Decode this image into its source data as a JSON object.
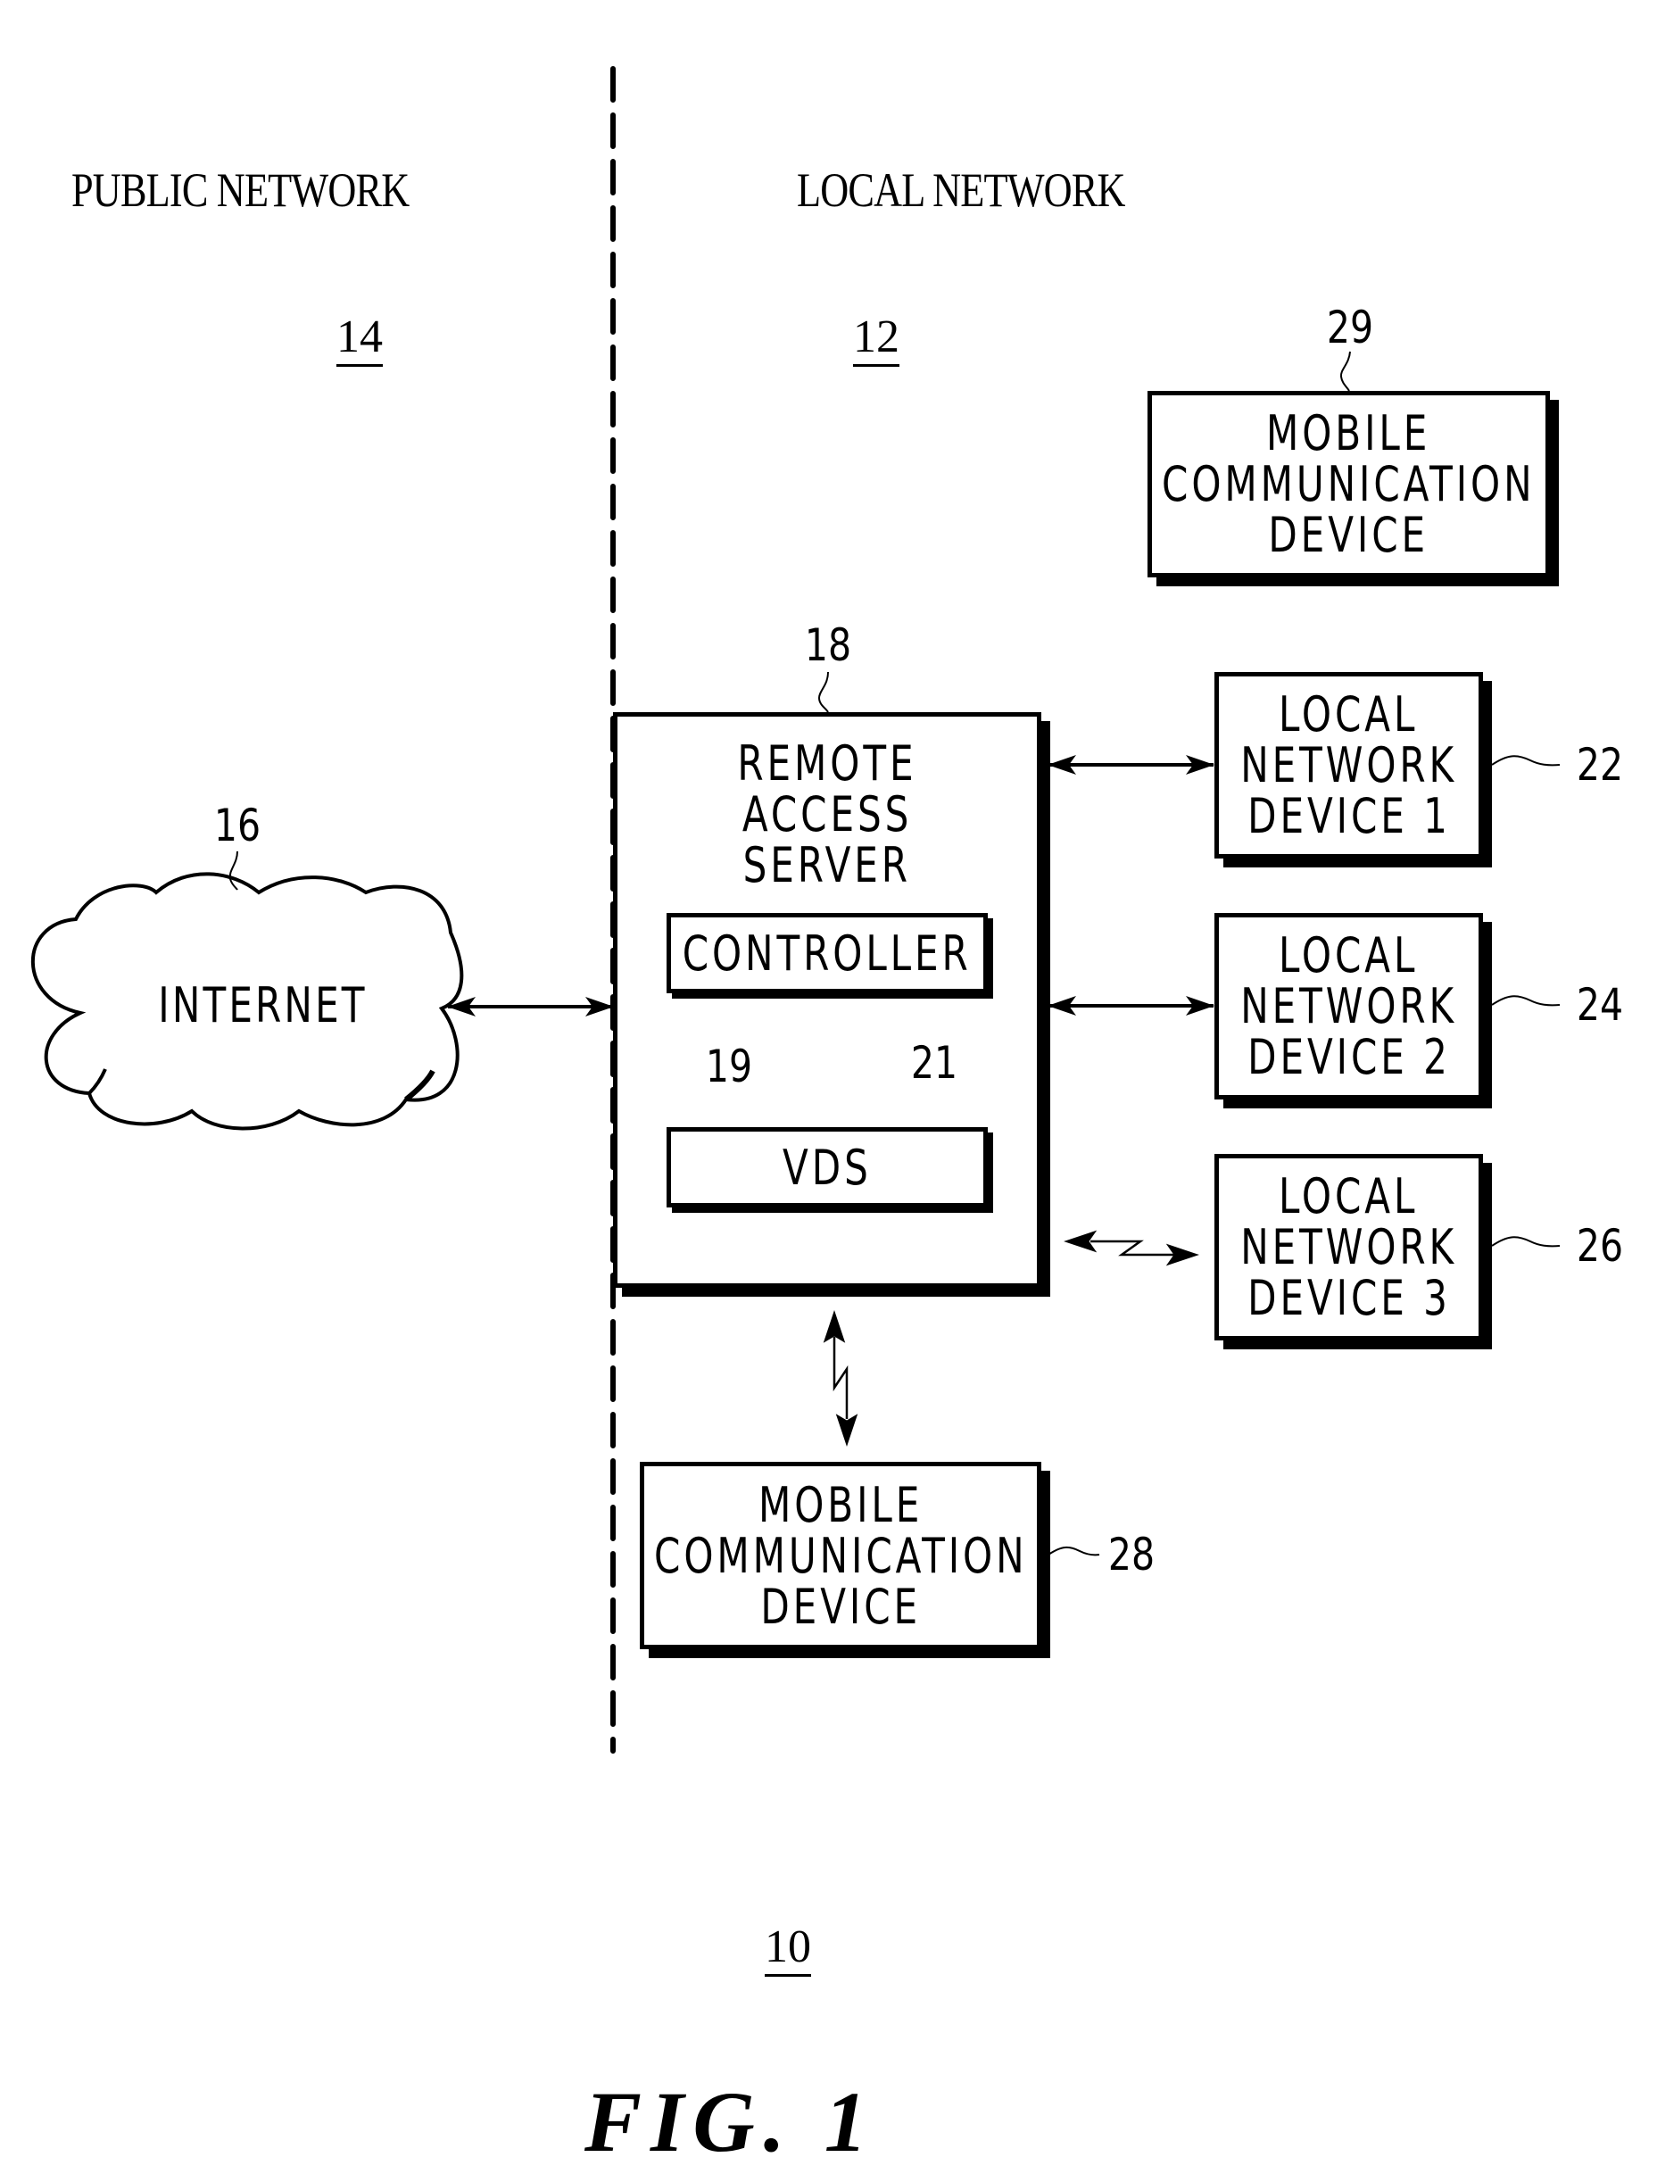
{
  "figure": {
    "title": "FIG. 1",
    "system_ref": "10"
  },
  "regions": {
    "public": {
      "label": "PUBLIC NETWORK",
      "ref": "14"
    },
    "local": {
      "label": "LOCAL NETWORK",
      "ref": "12"
    }
  },
  "internet": {
    "label": "INTERNET",
    "ref": "16"
  },
  "server": {
    "label_lines": [
      "REMOTE",
      "ACCESS",
      "SERVER"
    ],
    "ref": "18",
    "controller": {
      "label": "CONTROLLER",
      "ref": "19"
    },
    "vds": {
      "label": "VDS",
      "ref": "21"
    }
  },
  "local_devices": [
    {
      "label_lines": [
        "LOCAL",
        "NETWORK",
        "DEVICE 1"
      ],
      "ref": "22",
      "link": "wired"
    },
    {
      "label_lines": [
        "LOCAL",
        "NETWORK",
        "DEVICE 2"
      ],
      "ref": "24",
      "link": "wired"
    },
    {
      "label_lines": [
        "LOCAL",
        "NETWORK",
        "DEVICE 3"
      ],
      "ref": "26",
      "link": "wireless"
    }
  ],
  "mobile_devices": [
    {
      "label_lines": [
        "MOBILE",
        "COMMUNICATION",
        "DEVICE"
      ],
      "ref": "28",
      "link": "wireless"
    },
    {
      "label_lines": [
        "MOBILE",
        "COMMUNICATION",
        "DEVICE"
      ],
      "ref": "29",
      "link": "none"
    }
  ],
  "colors": {
    "ink": "#000000",
    "paper": "#ffffff"
  }
}
